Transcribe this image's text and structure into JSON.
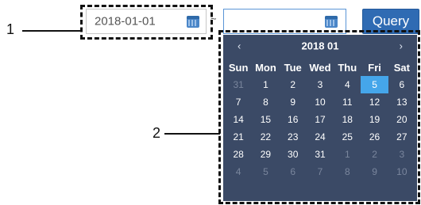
{
  "annotations": {
    "label_1": "1",
    "label_2": "2"
  },
  "date_from": {
    "value": "2018-01-01",
    "icon": "calendar-icon"
  },
  "separator": "~",
  "date_to": {
    "value": "",
    "icon": "calendar-icon"
  },
  "query_button": {
    "label": "Query"
  },
  "calendar": {
    "prev": "‹",
    "next": "›",
    "title": "2018 01",
    "weekdays": [
      "Sun",
      "Mon",
      "Tue",
      "Wed",
      "Thu",
      "Fri",
      "Sat"
    ],
    "weeks": [
      [
        {
          "d": "31",
          "m": true
        },
        {
          "d": "1"
        },
        {
          "d": "2"
        },
        {
          "d": "3"
        },
        {
          "d": "4"
        },
        {
          "d": "5",
          "sel": true
        },
        {
          "d": "6"
        }
      ],
      [
        {
          "d": "7"
        },
        {
          "d": "8"
        },
        {
          "d": "9"
        },
        {
          "d": "10"
        },
        {
          "d": "11"
        },
        {
          "d": "12"
        },
        {
          "d": "13"
        }
      ],
      [
        {
          "d": "14"
        },
        {
          "d": "15"
        },
        {
          "d": "16"
        },
        {
          "d": "17"
        },
        {
          "d": "18"
        },
        {
          "d": "19"
        },
        {
          "d": "20"
        }
      ],
      [
        {
          "d": "21"
        },
        {
          "d": "22"
        },
        {
          "d": "23"
        },
        {
          "d": "24"
        },
        {
          "d": "25"
        },
        {
          "d": "26"
        },
        {
          "d": "27"
        }
      ],
      [
        {
          "d": "28"
        },
        {
          "d": "29"
        },
        {
          "d": "30"
        },
        {
          "d": "31"
        },
        {
          "d": "1",
          "m": true
        },
        {
          "d": "2",
          "m": true
        },
        {
          "d": "3",
          "m": true
        }
      ],
      [
        {
          "d": "4",
          "m": true
        },
        {
          "d": "5",
          "m": true
        },
        {
          "d": "6",
          "m": true
        },
        {
          "d": "7",
          "m": true
        },
        {
          "d": "8",
          "m": true
        },
        {
          "d": "9",
          "m": true
        },
        {
          "d": "10",
          "m": true
        }
      ]
    ]
  },
  "colors": {
    "calendar_bg": "#3b4a66",
    "selected_day": "#45a6ea",
    "query_button": "#2f6bb3",
    "muted_day": "#7a869d"
  }
}
